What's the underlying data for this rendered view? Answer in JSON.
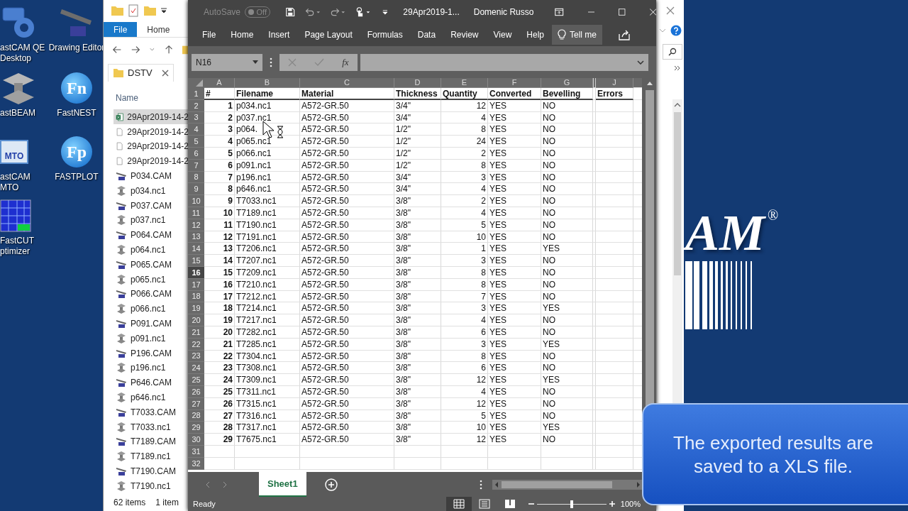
{
  "desktop_icons": [
    {
      "kind": "qe",
      "label": "astCAM QE Desktop"
    },
    {
      "kind": "beam",
      "label": "astBEAM"
    },
    {
      "kind": "mto",
      "label": "astCAM MTO",
      "badge": "MTO"
    },
    {
      "kind": "cut",
      "label": "FastCUT ptimizer"
    },
    {
      "kind": "drawing",
      "label": "Drawing Editor"
    },
    {
      "kind": "nest",
      "label": "FastNEST",
      "badge": "Fn"
    },
    {
      "kind": "plot",
      "label": "FASTPLOT",
      "badge": "Fp"
    }
  ],
  "explorer": {
    "ribbon_tabs": [
      {
        "label": "File",
        "selected": true
      },
      {
        "label": "Home",
        "selected": false
      }
    ],
    "folder_tab": "DSTV",
    "column": "Name",
    "files": [
      {
        "kind": "excel",
        "name": "29Apr2019-14-2",
        "selected": true
      },
      {
        "kind": "doc",
        "name": "29Apr2019-14-2",
        "selected": false
      },
      {
        "kind": "doc",
        "name": "29Apr2019-14-2",
        "selected": false
      },
      {
        "kind": "doc",
        "name": "29Apr2019-14-2",
        "selected": false
      },
      {
        "kind": "cam",
        "name": "P034.CAM",
        "selected": false
      },
      {
        "kind": "nc1",
        "name": "p034.nc1",
        "selected": false
      },
      {
        "kind": "cam",
        "name": "P037.CAM",
        "selected": false
      },
      {
        "kind": "nc1",
        "name": "p037.nc1",
        "selected": false
      },
      {
        "kind": "cam",
        "name": "P064.CAM",
        "selected": false
      },
      {
        "kind": "nc1",
        "name": "p064.nc1",
        "selected": false
      },
      {
        "kind": "cam",
        "name": "P065.CAM",
        "selected": false
      },
      {
        "kind": "nc1",
        "name": "p065.nc1",
        "selected": false
      },
      {
        "kind": "cam",
        "name": "P066.CAM",
        "selected": false
      },
      {
        "kind": "nc1",
        "name": "p066.nc1",
        "selected": false
      },
      {
        "kind": "cam",
        "name": "P091.CAM",
        "selected": false
      },
      {
        "kind": "nc1",
        "name": "p091.nc1",
        "selected": false
      },
      {
        "kind": "cam",
        "name": "P196.CAM",
        "selected": false
      },
      {
        "kind": "nc1",
        "name": "p196.nc1",
        "selected": false
      },
      {
        "kind": "cam",
        "name": "P646.CAM",
        "selected": false
      },
      {
        "kind": "nc1",
        "name": "p646.nc1",
        "selected": false
      },
      {
        "kind": "cam",
        "name": "T7033.CAM",
        "selected": false
      },
      {
        "kind": "nc1",
        "name": "T7033.nc1",
        "selected": false
      },
      {
        "kind": "cam",
        "name": "T7189.CAM",
        "selected": false
      },
      {
        "kind": "nc1",
        "name": "T7189.nc1",
        "selected": false
      },
      {
        "kind": "cam",
        "name": "T7190.CAM",
        "selected": false
      },
      {
        "kind": "nc1",
        "name": "T7190.nc1",
        "selected": false
      }
    ],
    "status": [
      "62 items",
      "1 item"
    ]
  },
  "excel": {
    "autosave": {
      "label": "AutoSave",
      "state": "Off",
      "on": false
    },
    "title": "29Apr2019-1...",
    "user": "Domenic Russo",
    "tabs": [
      {
        "label": "File",
        "selected": false
      },
      {
        "label": "Home",
        "selected": false
      },
      {
        "label": "Insert",
        "selected": false
      },
      {
        "label": "Page Layout",
        "selected": false
      },
      {
        "label": "Formulas",
        "selected": false
      },
      {
        "label": "Data",
        "selected": false
      },
      {
        "label": "Review",
        "selected": false
      },
      {
        "label": "View",
        "selected": false
      },
      {
        "label": "Help",
        "selected": false
      }
    ],
    "tell_me": "Tell me",
    "name_box": "N16",
    "function_label": "fx",
    "columns": [
      {
        "label": "A",
        "hidden_after": false
      },
      {
        "label": "B",
        "hidden_after": false
      },
      {
        "label": "C",
        "hidden_after": false
      },
      {
        "label": "D",
        "hidden_after": false
      },
      {
        "label": "E",
        "hidden_after": false
      },
      {
        "label": "F",
        "hidden_after": false
      },
      {
        "label": "G",
        "hidden_after": true
      },
      {
        "label": "J",
        "hidden_after": false
      }
    ],
    "row_numbers": [
      {
        "label": "1",
        "selected": false
      },
      {
        "label": "2",
        "selected": false
      },
      {
        "label": "3",
        "selected": false
      },
      {
        "label": "4",
        "selected": false
      },
      {
        "label": "5",
        "selected": false
      },
      {
        "label": "6",
        "selected": false
      },
      {
        "label": "7",
        "selected": false
      },
      {
        "label": "8",
        "selected": false
      },
      {
        "label": "9",
        "selected": false
      },
      {
        "label": "10",
        "selected": false
      },
      {
        "label": "11",
        "selected": false
      },
      {
        "label": "12",
        "selected": false
      },
      {
        "label": "13",
        "selected": false
      },
      {
        "label": "14",
        "selected": false
      },
      {
        "label": "15",
        "selected": false
      },
      {
        "label": "16",
        "selected": true
      },
      {
        "label": "17",
        "selected": false
      },
      {
        "label": "18",
        "selected": false
      },
      {
        "label": "19",
        "selected": false
      },
      {
        "label": "20",
        "selected": false
      },
      {
        "label": "21",
        "selected": false
      },
      {
        "label": "22",
        "selected": false
      },
      {
        "label": "23",
        "selected": false
      },
      {
        "label": "24",
        "selected": false
      },
      {
        "label": "25",
        "selected": false
      },
      {
        "label": "26",
        "selected": false
      },
      {
        "label": "27",
        "selected": false
      },
      {
        "label": "28",
        "selected": false
      },
      {
        "label": "29",
        "selected": false
      },
      {
        "label": "30",
        "selected": false
      },
      {
        "label": "31",
        "selected": false
      },
      {
        "label": "32",
        "selected": false
      }
    ],
    "header": [
      "#",
      "Filename",
      "Material",
      "Thickness",
      "Quantity",
      "Converted",
      "Bevelling",
      "Errors"
    ],
    "rows": [
      [
        "1",
        "p034.nc1",
        "A572-GR.50",
        "3/4\"",
        "12",
        "YES",
        "NO"
      ],
      [
        "2",
        "p037.nc1",
        "A572-GR.50",
        "3/4\"",
        "4",
        "YES",
        "NO"
      ],
      [
        "3",
        "p064.",
        "A572-GR.50",
        "1/2\"",
        "8",
        "YES",
        "NO"
      ],
      [
        "4",
        "p065.nc1",
        "A572-GR.50",
        "1/2\"",
        "24",
        "YES",
        "NO"
      ],
      [
        "5",
        "p066.nc1",
        "A572-GR.50",
        "1/2\"",
        "2",
        "YES",
        "NO"
      ],
      [
        "6",
        "p091.nc1",
        "A572-GR.50",
        "1/2\"",
        "8",
        "YES",
        "NO"
      ],
      [
        "7",
        "p196.nc1",
        "A572-GR.50",
        "3/4\"",
        "3",
        "YES",
        "NO"
      ],
      [
        "8",
        "p646.nc1",
        "A572-GR.50",
        "3/4\"",
        "4",
        "YES",
        "NO"
      ],
      [
        "9",
        "T7033.nc1",
        "A572-GR.50",
        "3/8\"",
        "2",
        "YES",
        "NO"
      ],
      [
        "10",
        "T7189.nc1",
        "A572-GR.50",
        "3/8\"",
        "4",
        "YES",
        "NO"
      ],
      [
        "11",
        "T7190.nc1",
        "A572-GR.50",
        "3/8\"",
        "5",
        "YES",
        "NO"
      ],
      [
        "12",
        "T7191.nc1",
        "A572-GR.50",
        "3/8\"",
        "10",
        "YES",
        "NO"
      ],
      [
        "13",
        "T7206.nc1",
        "A572-GR.50",
        "3/8\"",
        "1",
        "YES",
        "YES"
      ],
      [
        "14",
        "T7207.nc1",
        "A572-GR.50",
        "3/8\"",
        "3",
        "YES",
        "NO"
      ],
      [
        "15",
        "T7209.nc1",
        "A572-GR.50",
        "3/8\"",
        "8",
        "YES",
        "NO"
      ],
      [
        "16",
        "T7210.nc1",
        "A572-GR.50",
        "3/8\"",
        "8",
        "YES",
        "NO"
      ],
      [
        "17",
        "T7212.nc1",
        "A572-GR.50",
        "3/8\"",
        "7",
        "YES",
        "NO"
      ],
      [
        "18",
        "T7214.nc1",
        "A572-GR.50",
        "3/8\"",
        "3",
        "YES",
        "YES"
      ],
      [
        "19",
        "T7217.nc1",
        "A572-GR.50",
        "3/8\"",
        "4",
        "YES",
        "NO"
      ],
      [
        "20",
        "T7282.nc1",
        "A572-GR.50",
        "3/8\"",
        "6",
        "YES",
        "NO"
      ],
      [
        "21",
        "T7285.nc1",
        "A572-GR.50",
        "3/8\"",
        "3",
        "YES",
        "YES"
      ],
      [
        "22",
        "T7304.nc1",
        "A572-GR.50",
        "3/8\"",
        "8",
        "YES",
        "NO"
      ],
      [
        "23",
        "T7308.nc1",
        "A572-GR.50",
        "3/8\"",
        "6",
        "YES",
        "NO"
      ],
      [
        "24",
        "T7309.nc1",
        "A572-GR.50",
        "3/8\"",
        "12",
        "YES",
        "YES"
      ],
      [
        "25",
        "T7311.nc1",
        "A572-GR.50",
        "3/8\"",
        "4",
        "YES",
        "NO"
      ],
      [
        "26",
        "T7315.nc1",
        "A572-GR.50",
        "3/8\"",
        "12",
        "YES",
        "NO"
      ],
      [
        "27",
        "T7316.nc1",
        "A572-GR.50",
        "3/8\"",
        "5",
        "YES",
        "NO"
      ],
      [
        "28",
        "T7317.nc1",
        "A572-GR.50",
        "3/8\"",
        "10",
        "YES",
        "YES"
      ],
      [
        "29",
        "T7675.nc1",
        "A572-GR.50",
        "3/8\"",
        "12",
        "YES",
        "NO"
      ]
    ],
    "sheets": [
      {
        "label": "Sheet1",
        "selected": true
      }
    ],
    "status": "Ready",
    "views": [
      {
        "kind": "normal",
        "selected": true
      },
      {
        "kind": "page_layout",
        "selected": false
      },
      {
        "kind": "page_break",
        "selected": false
      }
    ],
    "zoom_slider": {
      "level": 0.5
    },
    "zoom": "100%"
  },
  "wallpaper": {
    "logo_text": "AM",
    "mark": "®"
  },
  "caption": "The exported results are saved to a XLS file."
}
